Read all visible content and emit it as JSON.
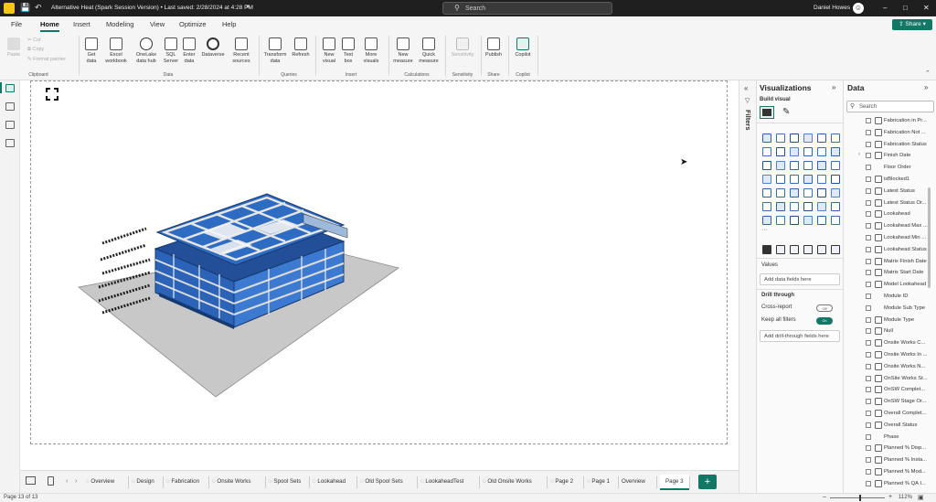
{
  "titlebar": {
    "document_title": "Alternative Heat (Spark Session Version) • Last saved: 2/28/2024 at 4:28 PM",
    "search_placeholder": "Search",
    "user_name": "Daniel Howes"
  },
  "menu": {
    "tabs": [
      {
        "label": "File"
      },
      {
        "label": "Home"
      },
      {
        "label": "Insert"
      },
      {
        "label": "Modeling"
      },
      {
        "label": "View"
      },
      {
        "label": "Optimize"
      },
      {
        "label": "Help"
      }
    ],
    "active_tab": "Home",
    "share_label": "Share"
  },
  "ribbon": {
    "clipboard": {
      "paste": "Paste",
      "cut": "Cut",
      "copy": "Copy",
      "format_painter": "Format painter",
      "group": "Clipboard"
    },
    "data": {
      "get_data": "Get data",
      "excel_workbook": "Excel workbook",
      "onelake_data_hub": "OneLake data hub",
      "sql_server": "SQL Server",
      "enter_data": "Enter data",
      "dataverse": "Dataverse",
      "recent_sources": "Recent sources",
      "group": "Data"
    },
    "queries": {
      "transform_data": "Transform data",
      "refresh": "Refresh",
      "group": "Queries"
    },
    "insert": {
      "new_visual": "New visual",
      "text_box": "Text box",
      "more_visuals": "More visuals",
      "group": "Insert"
    },
    "calculations": {
      "new_measure": "New measure",
      "quick_measure": "Quick measure",
      "group": "Calculations"
    },
    "sensitivity": {
      "sensitivity": "Sensitivity",
      "group": "Sensitivity"
    },
    "share": {
      "publish": "Publish",
      "group": "Share"
    },
    "copilot": {
      "copilot": "Copilot",
      "group": "Copilot"
    }
  },
  "filters": {
    "label": "Filters"
  },
  "visualizations": {
    "title": "Visualizations",
    "build_visual": "Build visual",
    "more": "···",
    "values_label": "Values",
    "add_data_fields": "Add data fields here",
    "drill_through": "Drill through",
    "cross_report": "Cross-report",
    "cross_report_state": "Off",
    "keep_all_filters": "Keep all filters",
    "keep_all_filters_state": "On",
    "add_drill_through": "Add drill-through fields here"
  },
  "data_pane": {
    "title": "Data",
    "search_placeholder": "Search",
    "fields": [
      {
        "label": "Fabrication in Pr...",
        "icon": true
      },
      {
        "label": "Fabrication Not ...",
        "icon": true
      },
      {
        "label": "Fabrication Status",
        "icon": true
      },
      {
        "label": "Finish Date",
        "icon": true,
        "expand": true
      },
      {
        "label": "Floor Order",
        "icon": false
      },
      {
        "label": "isBlocked1",
        "icon": true
      },
      {
        "label": "Latest Status",
        "icon": true
      },
      {
        "label": "Latest Status Or...",
        "icon": true
      },
      {
        "label": "Lookahead",
        "icon": true
      },
      {
        "label": "Lookahead Max ...",
        "icon": true
      },
      {
        "label": "Lookahead Min ...",
        "icon": true
      },
      {
        "label": "Lookahead Status",
        "icon": true
      },
      {
        "label": "Matrix Finish Date",
        "icon": true
      },
      {
        "label": "Matrix Start Date",
        "icon": true
      },
      {
        "label": "Model Lookahead",
        "icon": true
      },
      {
        "label": "Module ID",
        "icon": false
      },
      {
        "label": "Module Sub Type",
        "icon": false
      },
      {
        "label": "Module Type",
        "icon": true
      },
      {
        "label": "Null",
        "icon": true
      },
      {
        "label": "Onsite Works C...",
        "icon": true
      },
      {
        "label": "Onsite Works In ...",
        "icon": true
      },
      {
        "label": "Onsite Works N...",
        "icon": true
      },
      {
        "label": "OnSite Works St...",
        "icon": true
      },
      {
        "label": "OnSW Complet...",
        "icon": true
      },
      {
        "label": "OnSW Stage Or...",
        "icon": true
      },
      {
        "label": "Overall Complet...",
        "icon": true
      },
      {
        "label": "Overall Status",
        "icon": true
      },
      {
        "label": "Phase",
        "icon": false
      },
      {
        "label": "Planned % Disp...",
        "icon": true
      },
      {
        "label": "Planned % Insta...",
        "icon": true
      },
      {
        "label": "Planned % Mod...",
        "icon": true
      },
      {
        "label": "Planned % QA I...",
        "icon": true
      }
    ]
  },
  "page_tabs": [
    {
      "label": "Overview",
      "icon": true
    },
    {
      "label": "Design",
      "icon": true
    },
    {
      "label": "Fabrication",
      "icon": true
    },
    {
      "label": "Onsite Works",
      "icon": true
    },
    {
      "label": "Spool Sets",
      "icon": true
    },
    {
      "label": "Lookahead",
      "icon": true
    },
    {
      "label": "Old Spool Sets",
      "icon": true
    },
    {
      "label": "LookaheadTest",
      "icon": true
    },
    {
      "label": "Old Onsite Works",
      "icon": true
    },
    {
      "label": "Page 2",
      "icon": true
    },
    {
      "label": "Page 1",
      "icon": true
    },
    {
      "label": "Overview",
      "icon": false
    },
    {
      "label": "Page 3",
      "icon": false
    }
  ],
  "active_page": "Page 3",
  "status": {
    "page_indicator": "Page 13 of 13",
    "zoom": "112%"
  },
  "colors": {
    "accent": "#117865",
    "titlebar": "#1f1f1f",
    "model_blue": "#2a63b8",
    "model_grey": "#c9c9c9"
  }
}
